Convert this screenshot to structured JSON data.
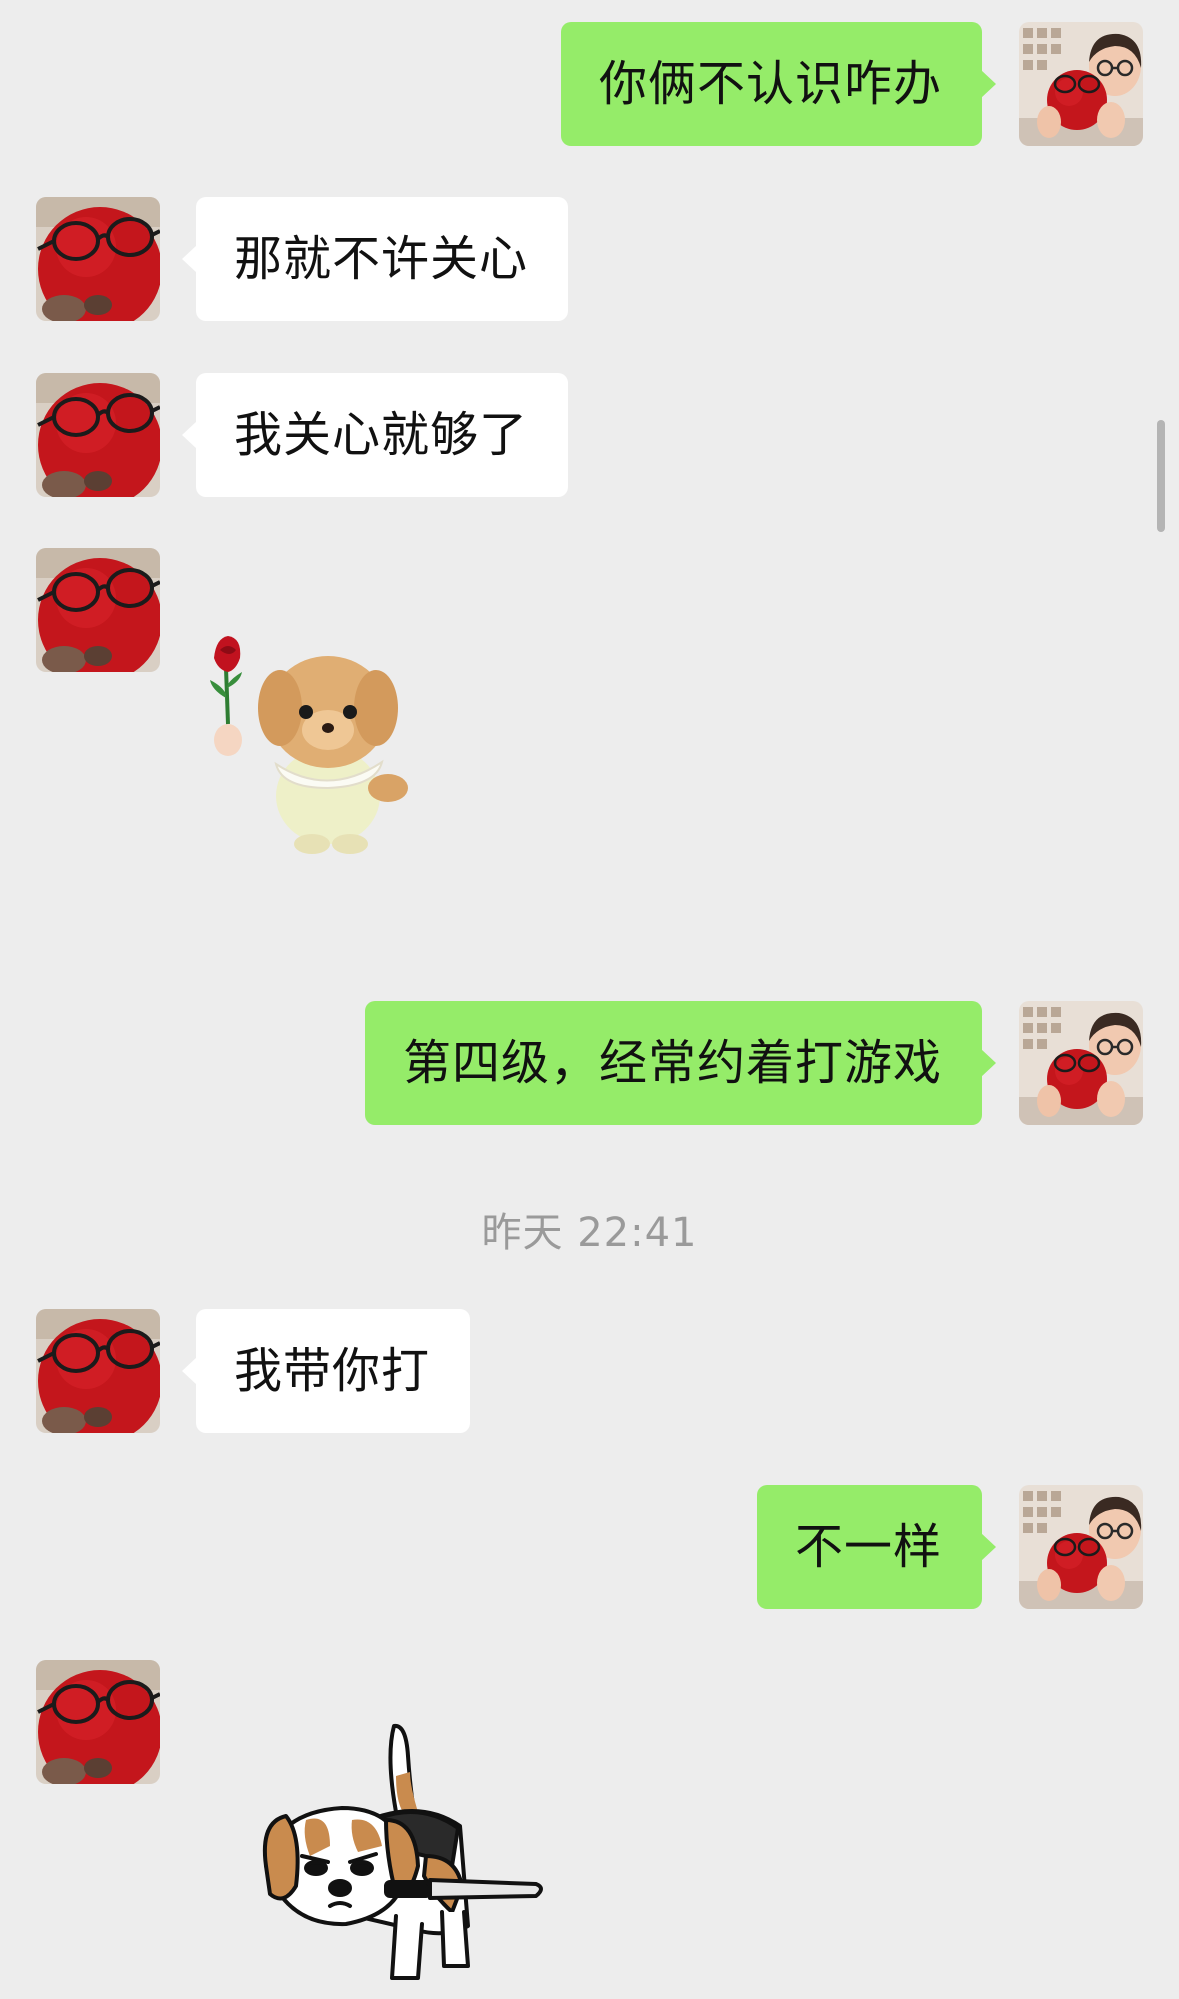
{
  "messages": [
    {
      "side": "out",
      "text": "你俩不认识咋办"
    },
    {
      "side": "in",
      "text": "那就不许关心"
    },
    {
      "side": "in",
      "text": "我关心就够了"
    },
    {
      "side": "in",
      "type": "sticker",
      "sticker": "puppy-with-rose-sticker"
    },
    {
      "side": "out",
      "text": "第四级，经常约着打游戏"
    },
    {
      "side": "in",
      "text": "我带你打"
    },
    {
      "side": "out",
      "text": "不一样"
    },
    {
      "side": "in",
      "type": "sticker",
      "sticker": "beagle-with-knife-sticker"
    }
  ],
  "timestamp": "昨天 22:41",
  "colors": {
    "background": "#ededed",
    "outgoing_bubble": "#95ec69",
    "incoming_bubble": "#ffffff",
    "timestamp_text": "#9a9a9a"
  },
  "avatars": {
    "contact": "red-plush-with-glasses-avatar",
    "self": "person-holding-red-plush-avatar"
  }
}
